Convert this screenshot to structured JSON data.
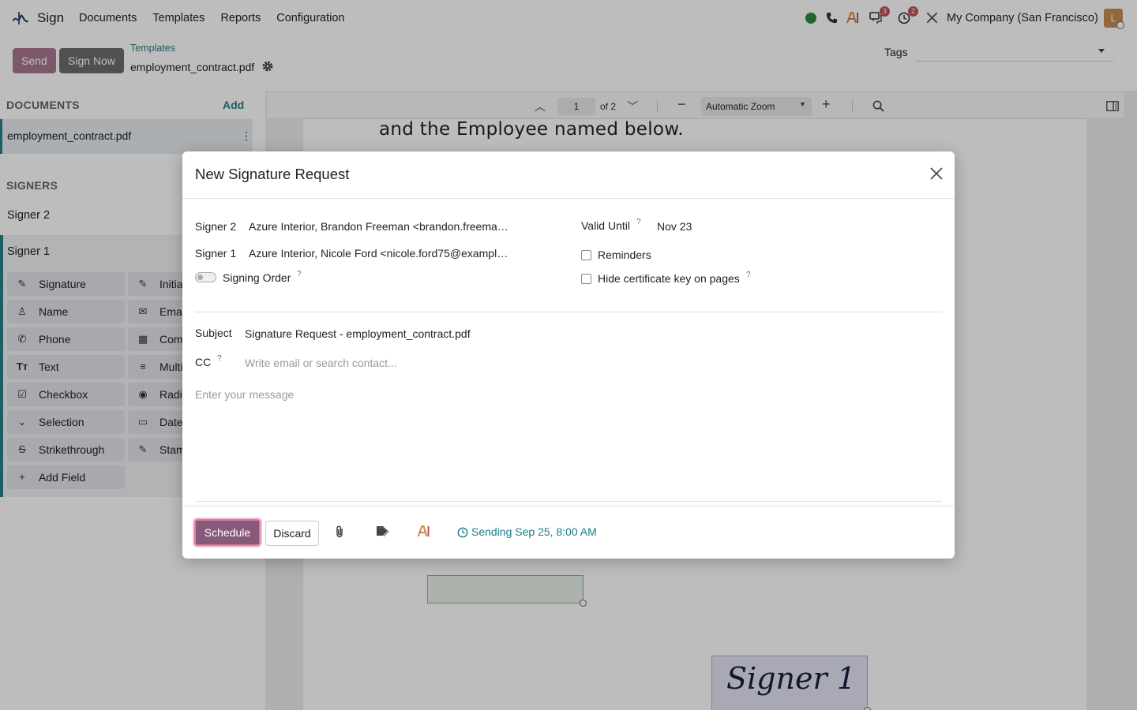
{
  "app": {
    "name": "Sign"
  },
  "menu": [
    "Documents",
    "Templates",
    "Reports",
    "Configuration"
  ],
  "systray": {
    "messages_badge": "3",
    "activities_badge": "2",
    "company": "My Company (San Francisco)",
    "avatar_initial": "L"
  },
  "control": {
    "send_label": "Send",
    "sign_now_label": "Sign Now",
    "breadcrumb_parent": "Templates",
    "breadcrumb_current": "employment_contract.pdf",
    "tags_label": "Tags"
  },
  "sidebar": {
    "documents_title": "DOCUMENTS",
    "add_label": "Add",
    "document": "employment_contract.pdf",
    "signers_title": "SIGNERS",
    "signers": [
      "Signer 2",
      "Signer 1"
    ],
    "fields_left": [
      "Signature",
      "Name",
      "Phone",
      "Text",
      "Checkbox",
      "Selection",
      "Strikethrough",
      "Add Field"
    ],
    "fields_right": [
      "Initia",
      "Ema",
      "Com",
      "Multi",
      "Radi",
      "Date",
      "Stam"
    ]
  },
  "viewer": {
    "page_number": "1",
    "page_of": "of 2",
    "zoom": "Automatic Zoom",
    "page_text": "and the Employee named below.",
    "signature_text": "Signer 1"
  },
  "modal": {
    "title": "New Signature Request",
    "signer2_label": "Signer 2",
    "signer2_value": "Azure Interior, Brandon Freeman <brandon.freeman…",
    "signer1_label": "Signer 1",
    "signer1_value": "Azure Interior, Nicole Ford <nicole.ford75@exampl…",
    "signing_order_label": "Signing Order",
    "valid_until_label": "Valid Until",
    "valid_until_value": "Nov 23",
    "reminders_label": "Reminders",
    "hide_cert_label": "Hide certificate key on pages",
    "subject_label": "Subject",
    "subject_value": "Signature Request - employment_contract.pdf",
    "cc_label": "CC",
    "cc_placeholder": "Write email or search contact...",
    "message_placeholder": "Enter your message",
    "help_mark": "?",
    "schedule_label": "Schedule",
    "discard_label": "Discard",
    "sending_label": "Sending Sep 25, 8:00 AM"
  },
  "colors": {
    "primary": "#875a7b",
    "link": "#2a7c86",
    "badge": "#c64e5a"
  }
}
